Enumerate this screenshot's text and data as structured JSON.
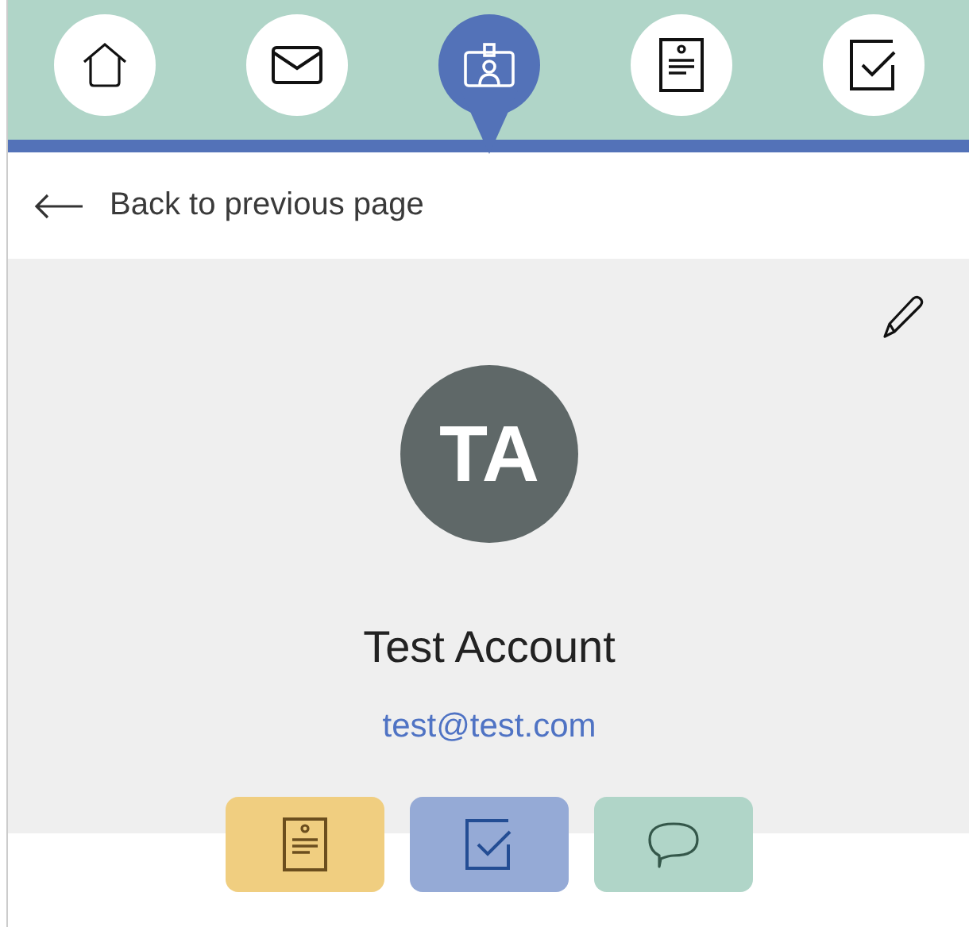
{
  "nav": [
    {
      "kind": "home",
      "selected": false
    },
    {
      "kind": "mail",
      "selected": false
    },
    {
      "kind": "badge",
      "selected": true
    },
    {
      "kind": "document",
      "selected": false
    },
    {
      "kind": "task",
      "selected": false
    }
  ],
  "back_link": {
    "label": "Back to previous page"
  },
  "profile": {
    "initials": "TA",
    "name": "Test Account",
    "email": "test@test.com"
  },
  "actions": [
    {
      "kind": "document",
      "color": "#f0ce80"
    },
    {
      "kind": "task",
      "color": "#95aad6"
    },
    {
      "kind": "chat",
      "color": "#b0d5c8"
    }
  ]
}
